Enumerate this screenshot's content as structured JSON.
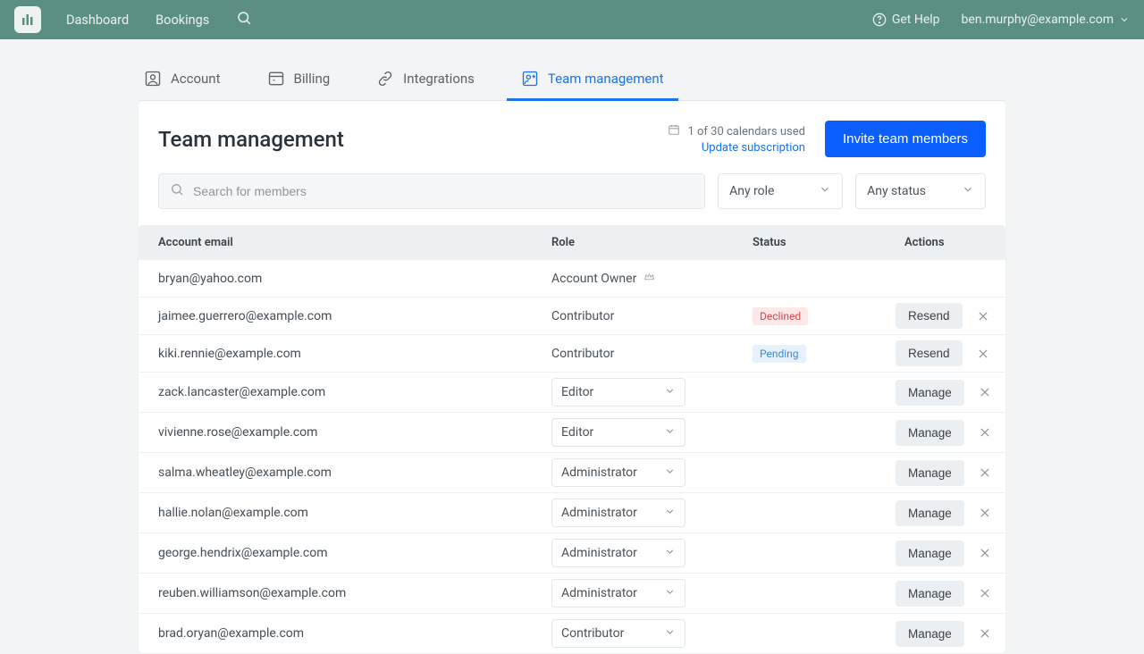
{
  "topnav": {
    "dashboard": "Dashboard",
    "bookings": "Bookings",
    "help": "Get Help",
    "user_email": "ben.murphy@example.com"
  },
  "tabs": {
    "account": "Account",
    "billing": "Billing",
    "integrations": "Integrations",
    "team": "Team management"
  },
  "header": {
    "title": "Team management",
    "calendars_used": "1 of 30 calendars used",
    "update_link": "Update subscription",
    "invite_label": "Invite team members"
  },
  "filters": {
    "search_placeholder": "Search for members",
    "role_any": "Any role",
    "status_any": "Any status"
  },
  "columns": {
    "email": "Account email",
    "role": "Role",
    "status": "Status",
    "actions": "Actions"
  },
  "buttons": {
    "resend": "Resend",
    "manage": "Manage"
  },
  "statuses": {
    "declined": "Declined",
    "pending": "Pending"
  },
  "roles": {
    "owner": "Account Owner",
    "contributor": "Contributor",
    "editor": "Editor",
    "administrator": "Administrator"
  },
  "rows": [
    {
      "email": "bryan@yahoo.com"
    },
    {
      "email": "jaimee.guerrero@example.com"
    },
    {
      "email": "kiki.rennie@example.com"
    },
    {
      "email": "zack.lancaster@example.com"
    },
    {
      "email": "vivienne.rose@example.com"
    },
    {
      "email": "salma.wheatley@example.com"
    },
    {
      "email": "hallie.nolan@example.com"
    },
    {
      "email": "george.hendrix@example.com"
    },
    {
      "email": "reuben.williamson@example.com"
    },
    {
      "email": "brad.oryan@example.com"
    }
  ]
}
